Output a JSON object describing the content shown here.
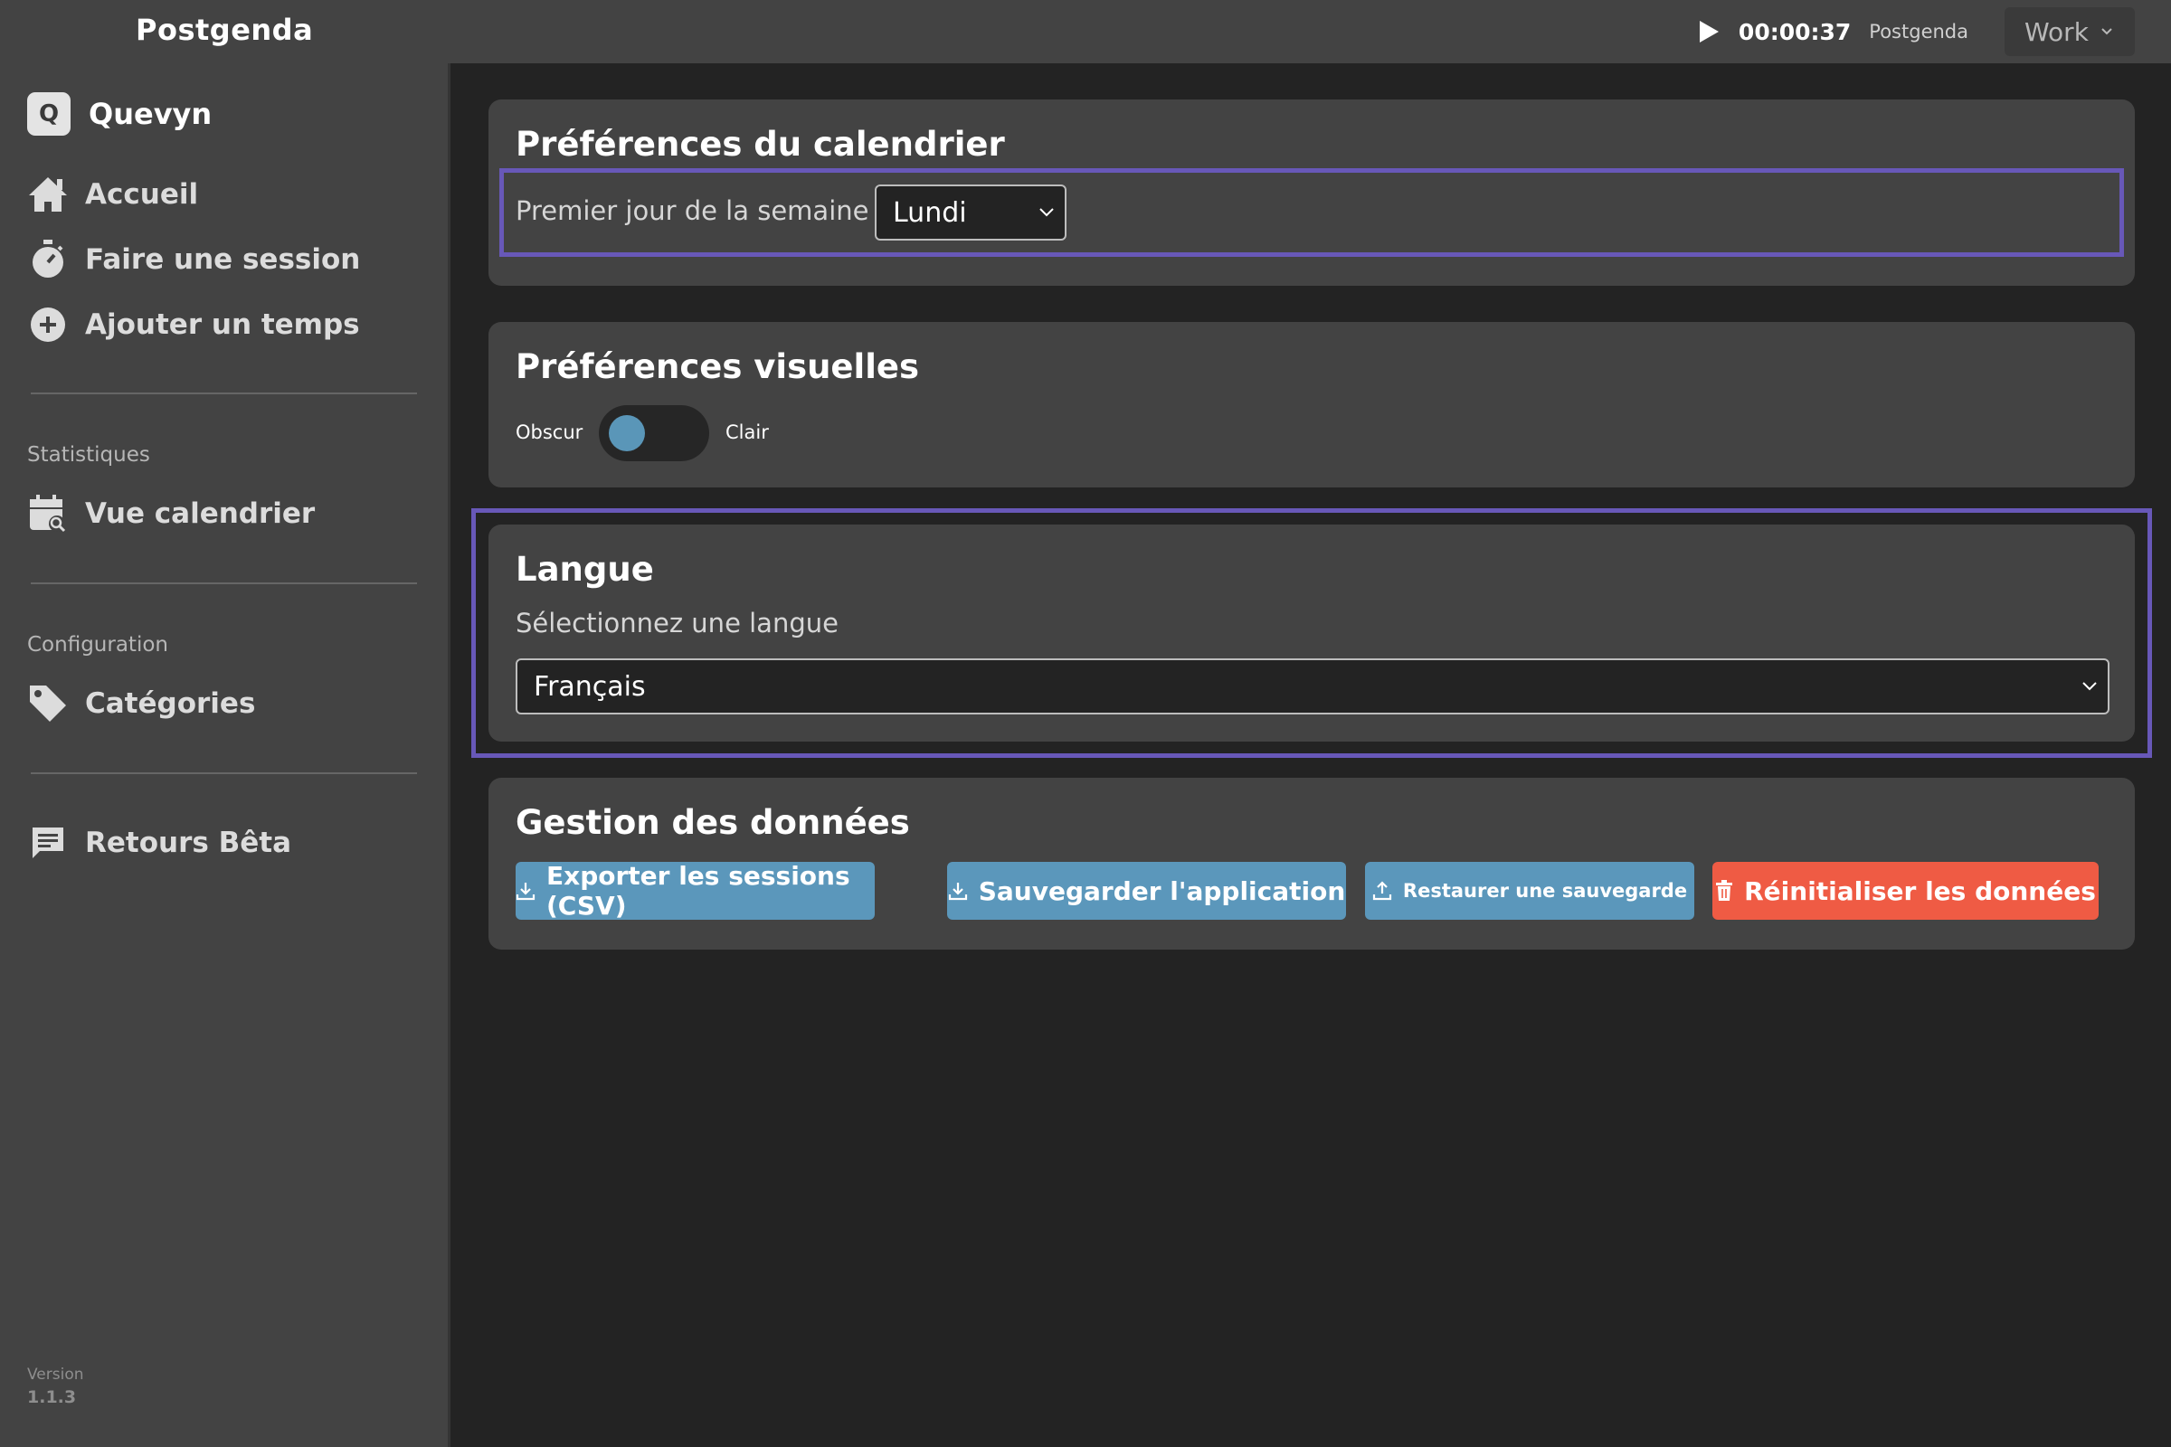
{
  "app_title": "Postgenda",
  "timer": {
    "elapsed": "00:00:37",
    "project": "Postgenda",
    "category_selected": "Work"
  },
  "sidebar": {
    "brand_letter": "Q",
    "brand_name": "Quevyn",
    "nav": {
      "home": "Accueil",
      "session": "Faire une session",
      "add_time": "Ajouter un temps",
      "calendar": "Vue calendrier",
      "categories": "Catégories",
      "feedback": "Retours Bêta"
    },
    "sections": {
      "stats": "Statistiques",
      "config": "Configuration"
    },
    "version_label": "Version",
    "version_value": "1.1.3"
  },
  "calendar_prefs": {
    "title": "Préférences du calendrier",
    "first_day_label": "Premier jour de la semaine",
    "first_day_value": "Lundi"
  },
  "visual_prefs": {
    "title": "Préférences visuelles",
    "dark_label": "Obscur",
    "light_label": "Clair",
    "toggle_state": "Obscur"
  },
  "language": {
    "title": "Langue",
    "select_label": "Sélectionnez une langue",
    "value": "Français"
  },
  "data_management": {
    "title": "Gestion des données",
    "export_csv": "Exporter les sessions (CSV)",
    "backup": "Sauvegarder l'application",
    "restore": "Restaurer une sauvegarde",
    "reset": "Réinitialiser les données"
  },
  "colors": {
    "accent_blue": "#5b97bb",
    "danger_red": "#ef5b44",
    "highlight_purple": "#6858b8",
    "panel": "#434343",
    "background": "#232323"
  },
  "icons": {
    "play": "play-icon",
    "home": "home-icon",
    "stopwatch": "stopwatch-icon",
    "add": "plus-circle-icon",
    "calendar": "calendar-search-icon",
    "tag": "tag-icon",
    "feedback": "message-icon",
    "download": "download-icon",
    "upload": "upload-icon",
    "trash": "trash-icon"
  }
}
